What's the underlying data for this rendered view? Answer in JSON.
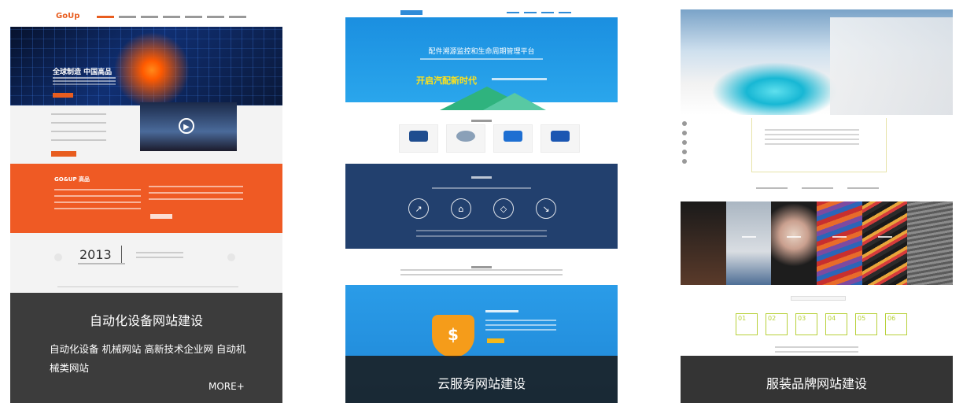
{
  "cards": [
    {
      "title": "自动化设备网站建设",
      "description": "自动化设备 机械网站 高新技术企业网 自动机械类网站",
      "more_label": "MORE+",
      "preview": {
        "logo": "GoUp",
        "hero_title": "全球制造 中国高品",
        "section_title": "GO&UP 高品",
        "year": "2013"
      }
    },
    {
      "title": "云服务网站建设",
      "preview": {
        "hero_title": "配件溯源监控和生命周期管理平台",
        "hero_slogan": "开启汽配新时代"
      }
    },
    {
      "title": "服装品牌网站建设",
      "preview": {
        "numbers": [
          "01",
          "02",
          "03",
          "04",
          "05",
          "06"
        ]
      }
    }
  ],
  "colors": {
    "card1_accent": "#ef5a24",
    "card2_accent": "#1b8fe0",
    "card2_dark": "#22406e",
    "overlay": "#1a1a1a"
  },
  "icons": {
    "play": "▶",
    "shield": "$"
  }
}
